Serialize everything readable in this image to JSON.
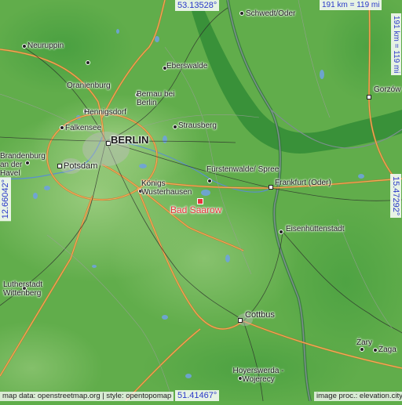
{
  "map": {
    "highlight": {
      "name": "Bad Saarow",
      "color": "#e8363c"
    },
    "cities": [
      {
        "name": "BERLIN",
        "size": "big"
      },
      {
        "name": "Potsdam"
      },
      {
        "name": "Frankfurt (Oder)"
      },
      {
        "name": "Cottbus"
      },
      {
        "name": "Gorzów"
      },
      {
        "name": "Schwedt/Oder"
      },
      {
        "name": "Neuruppin"
      },
      {
        "name": "Oranienburg"
      },
      {
        "name": "Hennigsdorf"
      },
      {
        "name": "Falkensee"
      },
      {
        "name": "Eberswalde"
      },
      {
        "name": "Bernau bei Berlin"
      },
      {
        "name": "Strausberg"
      },
      {
        "name": "Fürstenwalde/ Spree"
      },
      {
        "name": "Königs Wusterhausen"
      },
      {
        "name": "Eisenhüttenstadt"
      },
      {
        "name": "Brandenburg an der Havel"
      },
      {
        "name": "Lutherstadt Wittenberg"
      },
      {
        "name": "Hoyerswerda - Wojerecy"
      },
      {
        "name": "Żary"
      },
      {
        "name": "Żaga"
      }
    ],
    "coords": {
      "top": "53.13528°",
      "bottom": "51.41467°",
      "left": "12.66042°",
      "right": "15.47292°"
    },
    "scale": {
      "horizontal": "191 km = 119 mi",
      "vertical": "191 km = 119 mi"
    },
    "credits": {
      "left": "map data: openstreetmap.org | style: opentopomap",
      "right": "image proc.: elevation.city"
    }
  }
}
